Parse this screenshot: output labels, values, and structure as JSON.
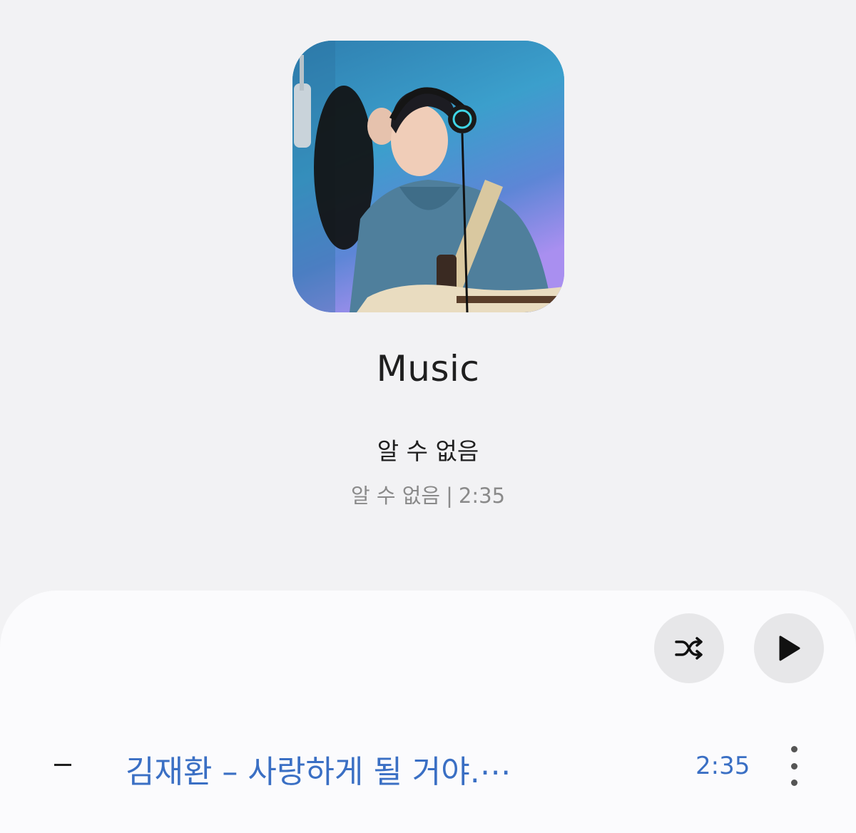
{
  "album": {
    "art_icon": "album-art-image"
  },
  "header": {
    "title": "Music",
    "artist": "알 수 없음",
    "meta_artist": "알 수 없음",
    "meta_separator": "|",
    "meta_duration": "2:35"
  },
  "controls": {
    "shuffle_icon": "shuffle-icon",
    "play_icon": "play-icon"
  },
  "tracks": [
    {
      "indicator": "–",
      "title": "김재환 – 사랑하게 될 거야.⋯",
      "duration": "2:35",
      "more_icon": "more-vertical-icon"
    }
  ],
  "colors": {
    "background": "#f2f2f4",
    "sheet": "#fbfbfd",
    "accent": "#3a6fc4",
    "button_bg": "#e7e7e9"
  }
}
